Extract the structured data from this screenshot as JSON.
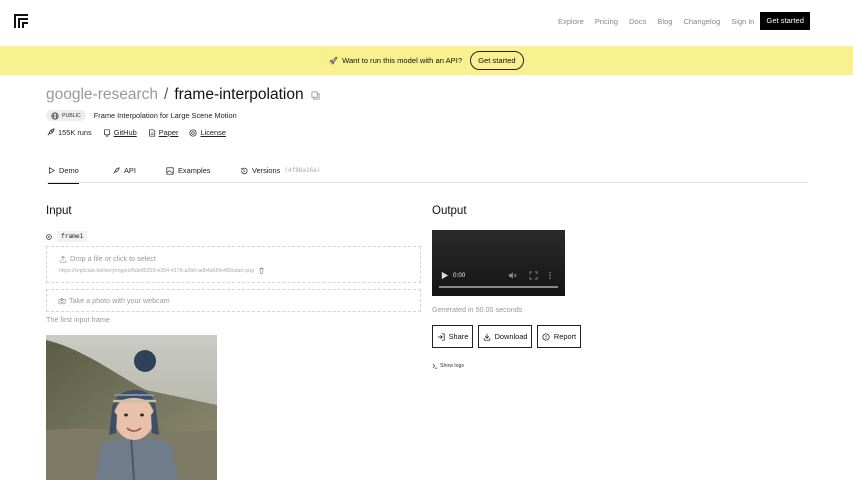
{
  "nav": {
    "links": [
      "Explore",
      "Pricing",
      "Docs",
      "Blog",
      "Changelog",
      "Sign in"
    ],
    "cta": "Get started"
  },
  "banner": {
    "emoji": "🚀",
    "text": "Want to run this model with an API?",
    "cta": "Get started",
    "color": "#f9f18f"
  },
  "model": {
    "owner": "google-research",
    "separator": "/",
    "name": "frame-interpolation",
    "visibility": "PUBLIC",
    "description": "Frame Interpolation for Large Scene Motion",
    "runs": "155K runs",
    "github": "GitHub",
    "paper": "Paper",
    "license": "License"
  },
  "tabs": {
    "demo": "Demo",
    "api": "API",
    "examples": "Examples",
    "versions": "Versions",
    "version_hash": "(4f88a16a)"
  },
  "input": {
    "heading": "Input",
    "field_name": "frame1",
    "drop_text": "Drop a file or click to select",
    "file_url": "https://replicate.delivery/mgxm/5de85319-e354-4178-a2b0-adb4a65fe480/start.png",
    "webcam_text": "Take a photo with your webcam",
    "help": "The first input frame"
  },
  "output": {
    "heading": "Output",
    "video_time": "0:00",
    "generated": "Generated in 50.00 seconds",
    "share": "Share",
    "download": "Download",
    "report": "Report",
    "show_logs": "Show logs"
  }
}
